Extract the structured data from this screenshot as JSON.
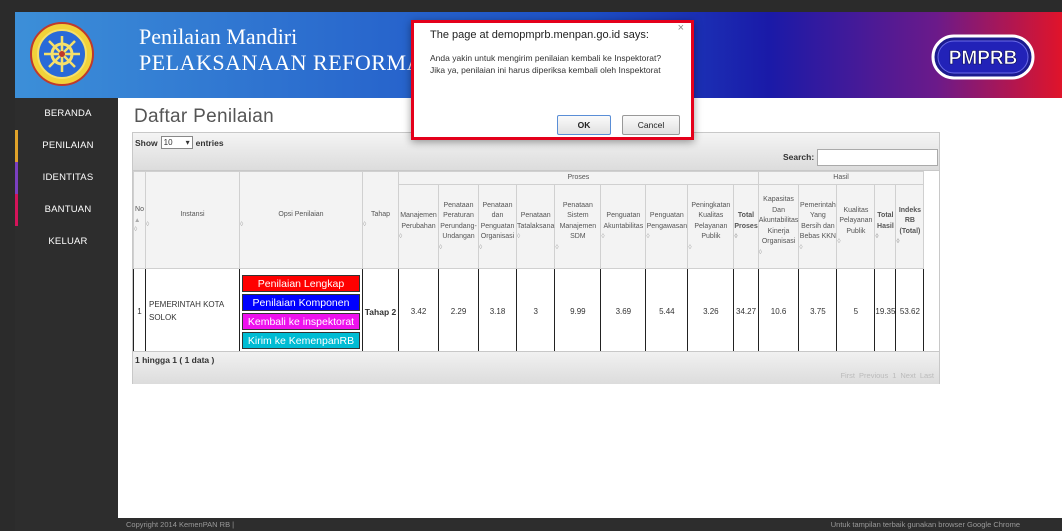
{
  "header": {
    "title_line1": "Penilaian Mandiri",
    "title_line2": "PELAKSANAAN REFORMASI BIROKRASI",
    "logo_text": "PMPRB"
  },
  "sidebar": {
    "items": [
      {
        "label": "BERANDA",
        "accent": "#2d2d2d"
      },
      {
        "label": "PENILAIAN",
        "accent": "#e0a22a"
      },
      {
        "label": "IDENTITAS",
        "accent": "#7b3fbf"
      },
      {
        "label": "BANTUAN",
        "accent": "#d4145a"
      },
      {
        "label": "KELUAR",
        "accent": "#2d2d2d"
      }
    ]
  },
  "main": {
    "page_title": "Daftar Penilaian",
    "show_label": "Show",
    "entries_value": "10",
    "entries_label": "entries",
    "search_label": "Search:",
    "info": "1 hingga 1 ( 1 data )",
    "pager": [
      "First",
      "Previous",
      "1",
      "Next",
      "Last"
    ]
  },
  "table": {
    "group_proses": "Proses",
    "group_hasil": "Hasil",
    "headers": {
      "no": "No",
      "instansi": "Instansi",
      "opsi": "Opsi Penilaian",
      "tahap": "Tahap",
      "proses": [
        "Manajemen Perubahan",
        "Penataan Peraturan Perundang-Undangan",
        "Penataan dan Penguatan Organisasi",
        "Penataan Tatalaksana",
        "Penataan Sistem Manajemen SDM",
        "Penguatan Akuntabilitas",
        "Penguatan Pengawasan",
        "Peningkatan Kualitas Pelayanan Publik"
      ],
      "total_proses": "Total Proses",
      "hasil": [
        "Kapasitas Dan Akuntabilitas Kinerja Organisasi",
        "Pemerintah Yang Bersih dan Bebas KKN",
        "Kualitas Pelayanan Publik"
      ],
      "total_hasil": "Total Hasil",
      "indeks": "Indeks RB (Total)"
    },
    "row": {
      "no": "1",
      "instansi": "PEMERINTAH KOTA SOLOK",
      "tahap": "Tahap 2",
      "proses": [
        "3.42",
        "2.29",
        "3.18",
        "3",
        "9.99",
        "3.69",
        "5.44",
        "3.26"
      ],
      "total_proses": "34.27",
      "hasil": [
        "10.6",
        "3.75",
        "5"
      ],
      "total_hasil": "19.35",
      "indeks": "53.62"
    },
    "options": [
      {
        "label": "Penilaian Lengkap",
        "color": "#ff0000"
      },
      {
        "label": "Penilaian Komponen",
        "color": "#0000ff"
      },
      {
        "label": "Kembali ke inspektorat",
        "color": "#ee11ee"
      },
      {
        "label": "Kirim ke KemenpanRB",
        "color": "#00bcd4"
      }
    ]
  },
  "dialog": {
    "title": "The page at demopmprb.menpan.go.id says:",
    "close": "×",
    "message": "Anda yakin untuk mengirim penilaian kembali ke Inspektorat? Jika ya, penilaian ini harus diperiksa kembali oleh Inspektorat",
    "ok": "OK",
    "cancel": "Cancel"
  },
  "footer": {
    "copyright": "Copyright 2014 KemenPAN RB |",
    "note": "Untuk tampilan terbaik gunakan browser Google Chrome"
  }
}
